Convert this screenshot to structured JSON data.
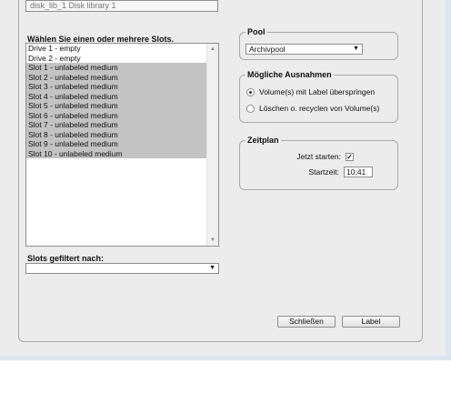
{
  "library_field": {
    "value": "disk_lib_1 Disk library 1"
  },
  "slots": {
    "heading": "Wählen Sie einen oder mehrere Slots.",
    "items": [
      {
        "label": "Drive 1 - empty",
        "selected": false
      },
      {
        "label": "Drive 2 - empty",
        "selected": false
      },
      {
        "label": "Slot 1 - unlabeled medium",
        "selected": true
      },
      {
        "label": "Slot 2 - unlabeled medium",
        "selected": true
      },
      {
        "label": "Slot 3 - unlabeled medium",
        "selected": true
      },
      {
        "label": "Slot 4 - unlabeled medium",
        "selected": true
      },
      {
        "label": "Slot 5 - unlabeled medium",
        "selected": true
      },
      {
        "label": "Slot 6 - unlabeled medium",
        "selected": true
      },
      {
        "label": "Slot 7 - unlabeled medium",
        "selected": true
      },
      {
        "label": "Slot 8 - unlabeled medium",
        "selected": true
      },
      {
        "label": "Slot 9 - unlabeled medium",
        "selected": true
      },
      {
        "label": "Slot 10 - unlabeled medium",
        "selected": true
      }
    ]
  },
  "filter": {
    "label": "Slots gefiltert nach:",
    "value": ""
  },
  "pool": {
    "legend": "Pool",
    "value": "Archivpool"
  },
  "exceptions": {
    "legend": "Mögliche Ausnahmen",
    "options": [
      {
        "label": "Volume(s) mit Label überspringen",
        "checked": true
      },
      {
        "label": "Löschen o. recyclen von Volume(s)",
        "checked": false
      }
    ]
  },
  "schedule": {
    "legend": "Zeitplan",
    "start_now_label": "Jetzt starten:",
    "start_now_checked": true,
    "start_time_label": "Startzeit:",
    "start_time_value": "10:41"
  },
  "buttons": {
    "close": "Schließen",
    "label": "Label"
  },
  "icons": {
    "caret": "chevron-down-icon",
    "scroll_up": "scroll-up-icon",
    "scroll_down": "scroll-down-icon",
    "check": "checkmark-icon"
  }
}
